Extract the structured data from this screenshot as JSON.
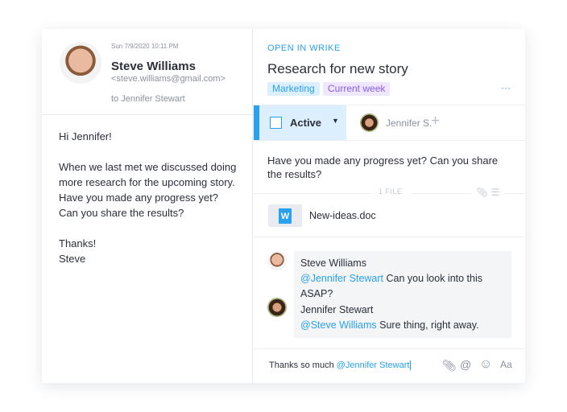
{
  "email": {
    "date": "Sun 7/9/2020 10:11 PM",
    "sender": "Steve Williams",
    "address": "<steve.williams@gmail.com>",
    "to": "to Jennifer Stewart",
    "body": [
      "Hi Jennifer!",
      "When we last met we discussed doing more research for the upcoming story. Have you made any progress yet? Can you share the results?",
      "Thanks!",
      "Steve"
    ]
  },
  "task": {
    "open_link": "OPEN IN WRIKE",
    "title": "Research for new story",
    "tags": [
      "Marketing",
      "Current week"
    ],
    "more": "···",
    "status": "Active",
    "assignee": "Jennifer S.",
    "add": "+",
    "description": "Have you made any progress yet? Can you share the results?",
    "files_label": "1 FILE",
    "file_name": "New-ideas.doc",
    "file_icon": "W"
  },
  "comments": [
    {
      "author": "Steve Williams",
      "mention": "@Jennifer Stewart",
      "text": " Can you look into this ASAP?"
    },
    {
      "author": "Jennifer Stewart",
      "mention": "@Steve Williams",
      "text": " Sure thing, right away."
    }
  ],
  "composer": {
    "text": "Thanks so much ",
    "mention": "@Jennifer Stewart",
    "format": "Aa"
  },
  "colors": {
    "accent": "#2aa0f0",
    "status_bg": "#dcefff",
    "tag_marketing_bg": "#dcefff",
    "tag_week_bg": "#efe6ff",
    "tag_week_fg": "#8a5cf0"
  }
}
